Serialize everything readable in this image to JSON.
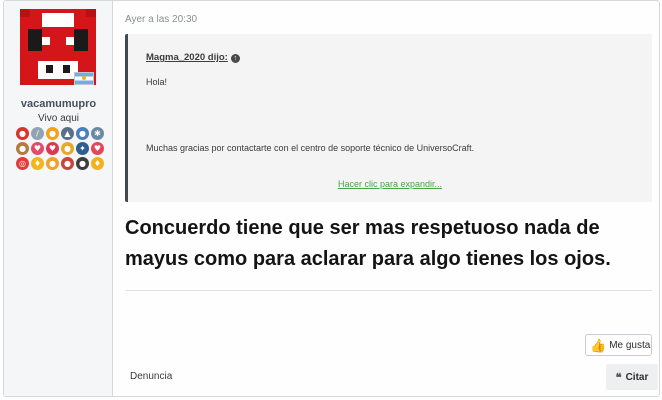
{
  "user": {
    "username": "vacamumupro",
    "title": "Vivo aqui",
    "avatar_icon": "pixel-cow-avatar",
    "flag_icon": "argentina-flag-icon",
    "badges": [
      {
        "icon": "trophy-badge-icon",
        "color": "#d9342b",
        "glyph": "●"
      },
      {
        "icon": "sword-badge-icon",
        "color": "#8fa3b5",
        "glyph": "/"
      },
      {
        "icon": "medal-badge-icon",
        "color": "#f0a31c",
        "glyph": "●"
      },
      {
        "icon": "rocket-badge-icon",
        "color": "#5a6f8a",
        "glyph": "▲"
      },
      {
        "icon": "person-badge-icon",
        "color": "#4a7fbd",
        "glyph": "●"
      },
      {
        "icon": "gear-badge-icon",
        "color": "#6c8aa6",
        "glyph": "✱"
      },
      {
        "icon": "group-badge-icon",
        "color": "#b7793f",
        "glyph": "●"
      },
      {
        "icon": "heart-arrow-badge-icon",
        "color": "#e34b6b",
        "glyph": "♥"
      },
      {
        "icon": "heart-badge-icon",
        "color": "#e0364f",
        "glyph": "♥"
      },
      {
        "icon": "medal-gold-badge-icon",
        "color": "#e7a82b",
        "glyph": "●"
      },
      {
        "icon": "compass-badge-icon",
        "color": "#2f5f8a",
        "glyph": "✦"
      },
      {
        "icon": "chat-heart-badge-icon",
        "color": "#e5475a",
        "glyph": "♥"
      },
      {
        "icon": "target-badge-icon",
        "color": "#e33a3a",
        "glyph": "◎"
      },
      {
        "icon": "trophy-small-badge-icon",
        "color": "#f2b51a",
        "glyph": "♦"
      },
      {
        "icon": "ribbon-badge-icon",
        "color": "#f0a22a",
        "glyph": "●"
      },
      {
        "icon": "ribbon-red-badge-icon",
        "color": "#c8443b",
        "glyph": "●"
      },
      {
        "icon": "ribbon-dark-badge-icon",
        "color": "#3e3e3e",
        "glyph": "●"
      },
      {
        "icon": "cup-badge-icon",
        "color": "#f2b21d",
        "glyph": "♦"
      }
    ]
  },
  "post": {
    "timestamp": "Ayer a las 20:30",
    "quote": {
      "author": "Magma_2020 dijo:",
      "line1": "Hola!",
      "line2": "Muchas gracias por contactarte con el centro de soporte técnico de UniversoCraft.",
      "expand": "Hacer clic para expandir..."
    },
    "message": "Concuerdo tiene que ser mas respetuoso nada de mayus como para aclarar para algo tienes los ojos."
  },
  "actions": {
    "like_label": "Me gusta",
    "report_label": "Denuncia",
    "quote_label": "Citar"
  }
}
